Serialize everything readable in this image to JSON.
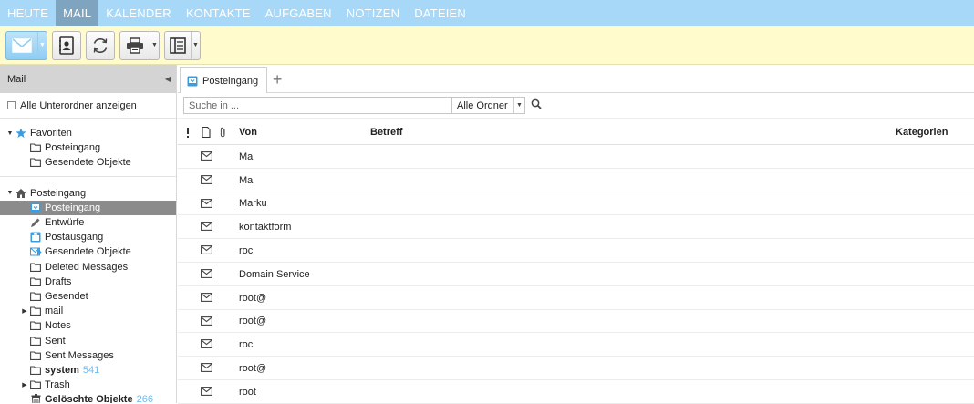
{
  "nav": {
    "items": [
      {
        "label": "HEUTE",
        "active": false
      },
      {
        "label": "MAIL",
        "active": true
      },
      {
        "label": "KALENDER",
        "active": false
      },
      {
        "label": "KONTAKTE",
        "active": false
      },
      {
        "label": "AUFGABEN",
        "active": false
      },
      {
        "label": "NOTIZEN",
        "active": false
      },
      {
        "label": "DATEIEN",
        "active": false
      }
    ]
  },
  "toolbar": {
    "buttons": [
      {
        "icon": "new-mail-icon",
        "dropdown": true
      },
      {
        "icon": "address-book-icon",
        "dropdown": false
      },
      {
        "icon": "refresh-icon",
        "dropdown": false
      },
      {
        "icon": "print-icon",
        "dropdown": true
      },
      {
        "icon": "layout-icon",
        "dropdown": true
      }
    ]
  },
  "sidebar": {
    "title": "Mail",
    "show_subfolders_label": "Alle Unterordner anzeigen",
    "favorites": {
      "label": "Favoriten",
      "items": [
        {
          "label": "Posteingang"
        },
        {
          "label": "Gesendete Objekte"
        }
      ]
    },
    "mailbox": {
      "label": "Posteingang",
      "items": [
        {
          "label": "Posteingang",
          "icon": "inbox-icon",
          "selected": true,
          "bold": false,
          "count": ""
        },
        {
          "label": "Entwürfe",
          "icon": "pencil-icon",
          "selected": false,
          "bold": false,
          "count": ""
        },
        {
          "label": "Postausgang",
          "icon": "outbox-icon",
          "selected": false,
          "bold": false,
          "count": ""
        },
        {
          "label": "Gesendete Objekte",
          "icon": "sent-icon",
          "selected": false,
          "bold": false,
          "count": ""
        },
        {
          "label": "Deleted Messages",
          "icon": "folder-icon",
          "selected": false,
          "bold": false,
          "count": ""
        },
        {
          "label": "Drafts",
          "icon": "folder-icon",
          "selected": false,
          "bold": false,
          "count": ""
        },
        {
          "label": "Gesendet",
          "icon": "folder-icon",
          "selected": false,
          "bold": false,
          "count": ""
        },
        {
          "label": "mail",
          "icon": "folder-icon",
          "selected": false,
          "bold": false,
          "count": "",
          "expandable": true
        },
        {
          "label": "Notes",
          "icon": "folder-icon",
          "selected": false,
          "bold": false,
          "count": ""
        },
        {
          "label": "Sent",
          "icon": "folder-icon",
          "selected": false,
          "bold": false,
          "count": ""
        },
        {
          "label": "Sent Messages",
          "icon": "folder-icon",
          "selected": false,
          "bold": false,
          "count": ""
        },
        {
          "label": "system",
          "icon": "folder-icon",
          "selected": false,
          "bold": true,
          "count": "541"
        },
        {
          "label": "Trash",
          "icon": "folder-icon",
          "selected": false,
          "bold": false,
          "count": "",
          "expandable": true
        },
        {
          "label": "Gelöschte Objekte",
          "icon": "trash-icon",
          "selected": false,
          "bold": true,
          "count": "266"
        }
      ]
    }
  },
  "main": {
    "tab": {
      "label": "Posteingang"
    },
    "search": {
      "placeholder": "Suche in ...",
      "scope": "Alle Ordner"
    },
    "columns": {
      "from": "Von",
      "subject": "Betreff",
      "categories": "Kategorien"
    },
    "messages": [
      {
        "from": "Ma"
      },
      {
        "from": "Ma"
      },
      {
        "from": "Marku"
      },
      {
        "from": "kontaktform"
      },
      {
        "from": "roc"
      },
      {
        "from": "Domain Service"
      },
      {
        "from": "root@"
      },
      {
        "from": "root@"
      },
      {
        "from": "roc"
      },
      {
        "from": "root@"
      },
      {
        "from": "root"
      }
    ]
  }
}
